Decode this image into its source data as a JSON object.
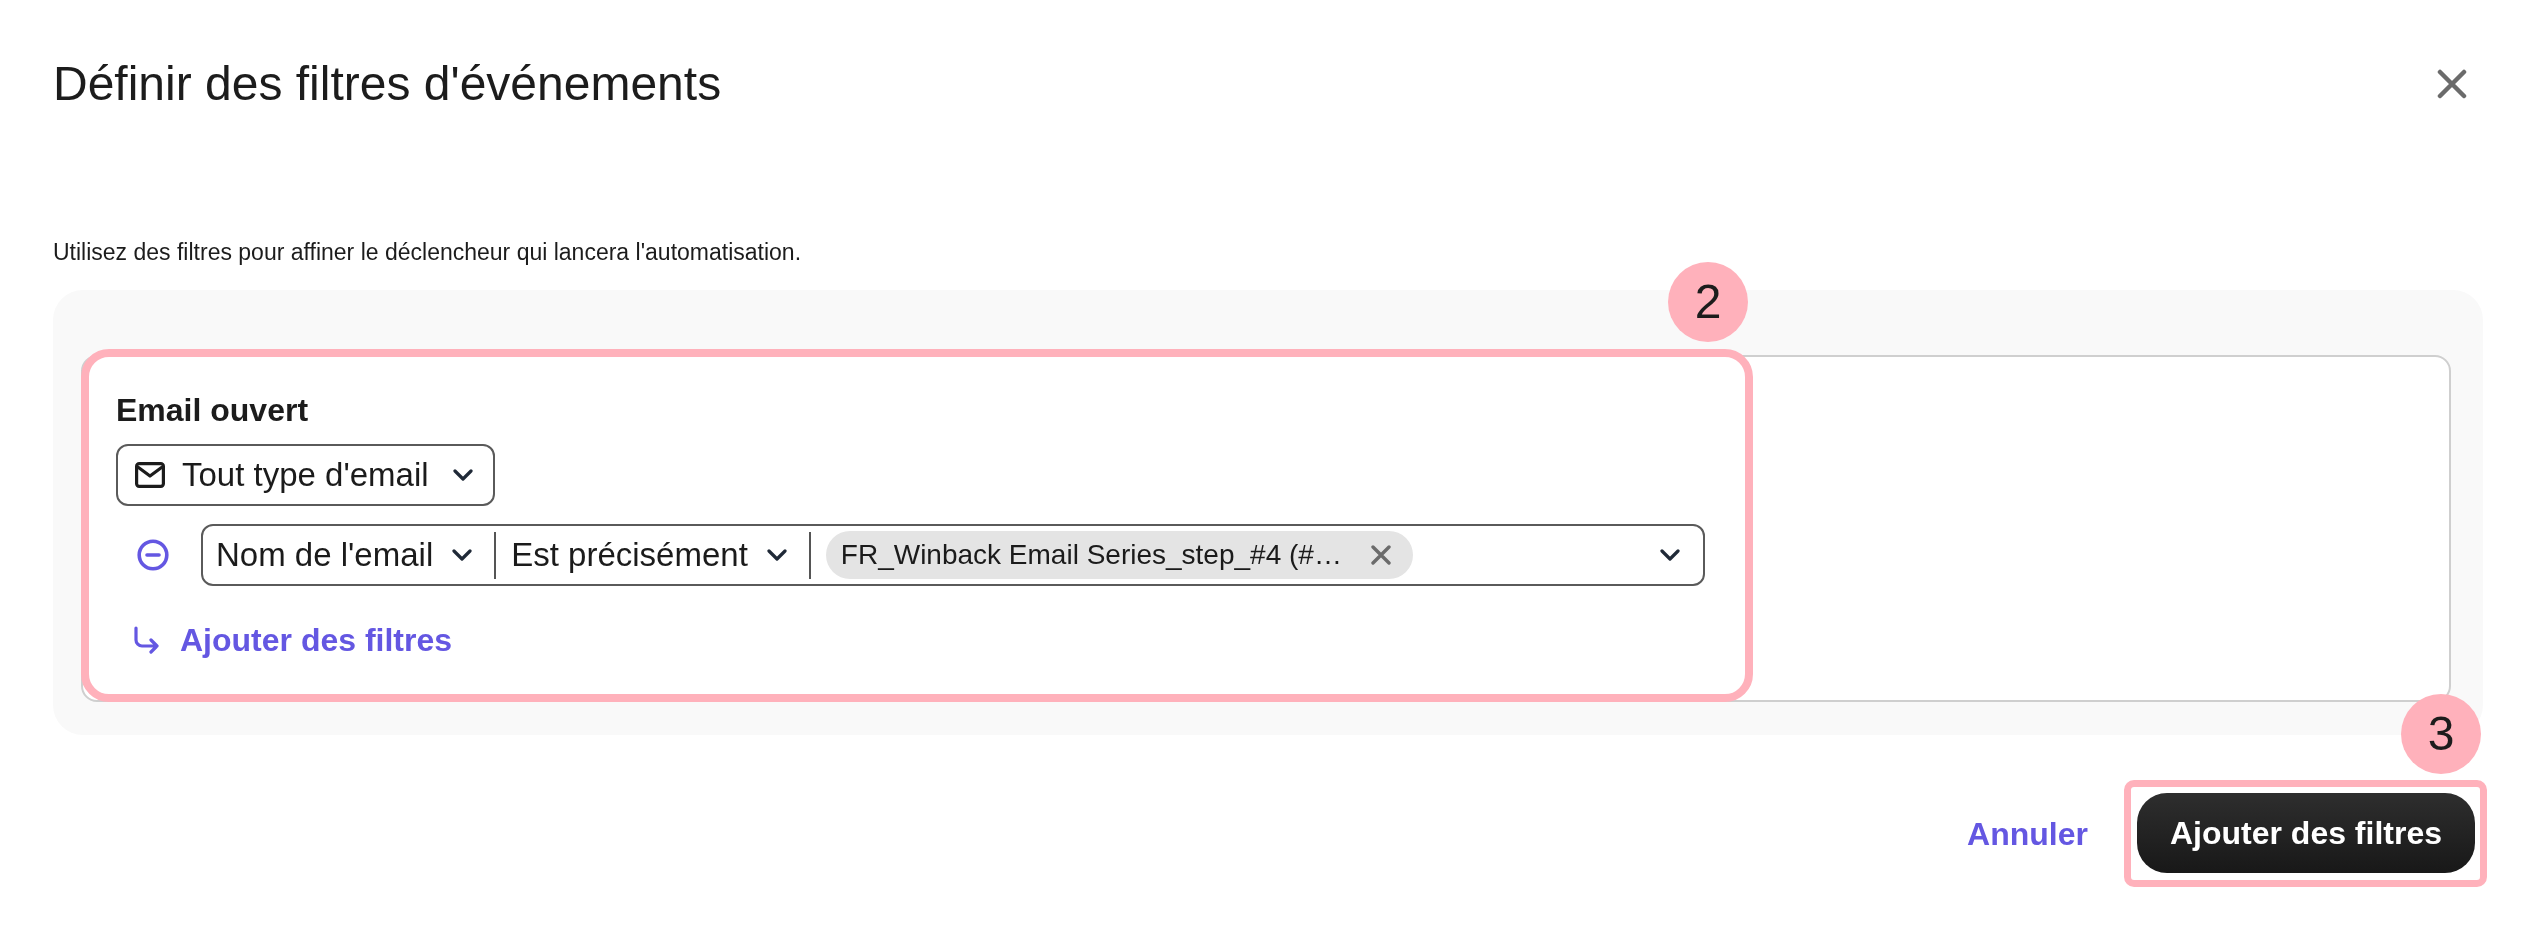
{
  "dialog": {
    "title": "Définir des filtres d'événements",
    "description": "Utilisez des filtres pour affiner le déclencheur qui lancera l'automatisation."
  },
  "filter_group": {
    "title": "Email ouvert",
    "step_badge": "2",
    "email_type": "Tout type d'email",
    "conditions": [
      {
        "field": "Nom de l'email",
        "operator": "Est précisément",
        "values": [
          "FR_Winback Email Series_step_#4 (#…"
        ]
      }
    ],
    "add_filter_link": "Ajouter des filtres"
  },
  "footer": {
    "cancel_button": "Annuler",
    "submit_button": "Ajouter des filtres",
    "step_badge": "3"
  }
}
